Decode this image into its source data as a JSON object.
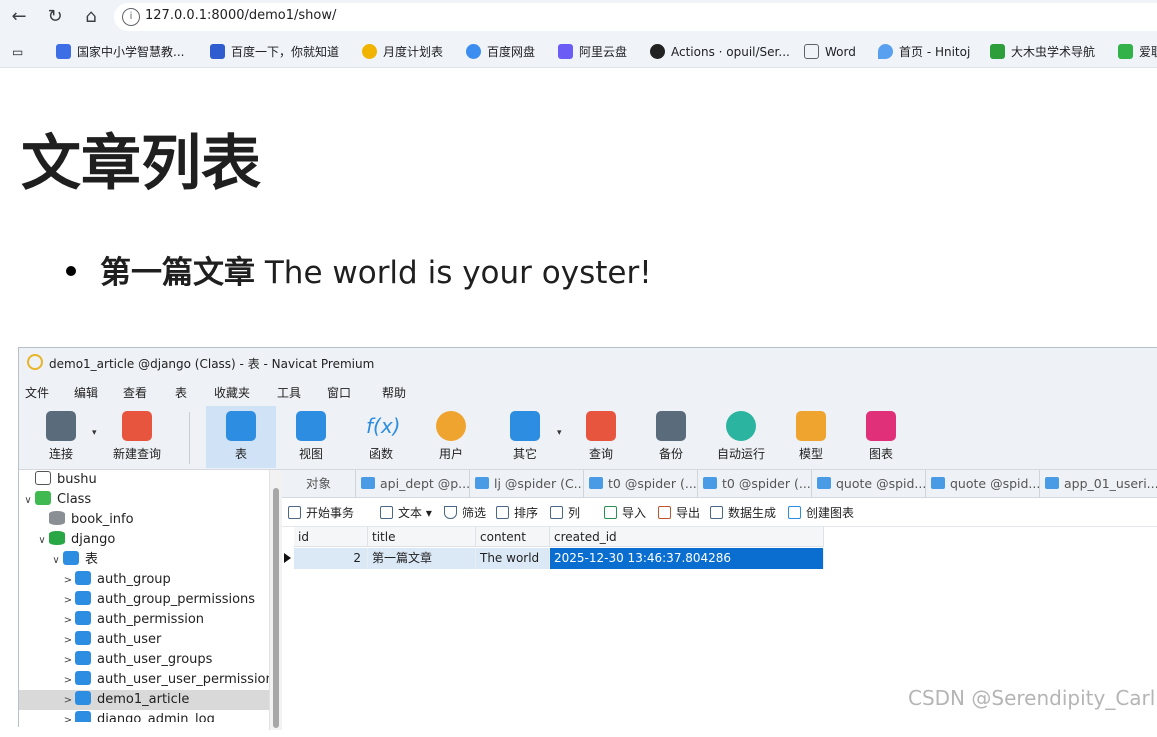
{
  "browser": {
    "url": "127.0.0.1:8000/demo1/show/",
    "bookmarks": [
      {
        "label": "国家中小学智慧教...",
        "color": "#3d6ee6"
      },
      {
        "label": "百度一下，你就知道",
        "color": "#2f5ccf"
      },
      {
        "label": "月度计划表",
        "color": "#f0b400"
      },
      {
        "label": "百度网盘",
        "color": "#3b8ef0"
      },
      {
        "label": "阿里云盘",
        "color": "#6b5cf6"
      },
      {
        "label": "Actions · opuil/Ser...",
        "color": "#222222"
      },
      {
        "label": "Word",
        "color": "#5f6368"
      },
      {
        "label": "首页 - Hnitoj",
        "color": "#5aa0f0"
      },
      {
        "label": "大木虫学术导航",
        "color": "#2e9e3a"
      },
      {
        "label": "爱职",
        "color": "#33b24a"
      }
    ]
  },
  "page": {
    "heading": "文章列表",
    "articles": [
      {
        "title": "第一篇文章",
        "content": "The world is your oyster!"
      }
    ]
  },
  "navicat": {
    "title": "demo1_article @django (Class) - 表 - Navicat Premium",
    "menus": [
      "文件",
      "编辑",
      "查看",
      "表",
      "收藏夹",
      "工具",
      "窗口",
      "帮助"
    ],
    "toolbar": [
      {
        "label": "连接",
        "color": "#5a6b7c"
      },
      {
        "label": "新建查询",
        "color": "#e8553f"
      },
      {
        "label": "表",
        "color": "#2d8de0"
      },
      {
        "label": "视图",
        "color": "#2d8de0"
      },
      {
        "label": "函数",
        "color": "#2d8de0"
      },
      {
        "label": "用户",
        "color": "#f0a430"
      },
      {
        "label": "其它",
        "color": "#2d8de0"
      },
      {
        "label": "查询",
        "color": "#e8553f"
      },
      {
        "label": "备份",
        "color": "#5a6b7c"
      },
      {
        "label": "自动运行",
        "color": "#2bb5a0"
      },
      {
        "label": "模型",
        "color": "#f0a430"
      },
      {
        "label": "图表",
        "color": "#e0307a"
      }
    ],
    "tree": [
      {
        "label": "bushu",
        "arrow": ""
      },
      {
        "label": "Class",
        "arrow": "∨"
      },
      {
        "label": "book_info",
        "arrow": ""
      },
      {
        "label": "django",
        "arrow": "∨"
      },
      {
        "label": "表",
        "arrow": "∨"
      },
      {
        "label": "auth_group",
        "arrow": ">"
      },
      {
        "label": "auth_group_permissions",
        "arrow": ">"
      },
      {
        "label": "auth_permission",
        "arrow": ">"
      },
      {
        "label": "auth_user",
        "arrow": ">"
      },
      {
        "label": "auth_user_groups",
        "arrow": ">"
      },
      {
        "label": "auth_user_user_permissions",
        "arrow": ">"
      },
      {
        "label": "demo1_article",
        "arrow": ">"
      },
      {
        "label": "django_admin_log",
        "arrow": ">"
      }
    ],
    "tabs": [
      "对象",
      "api_dept @p...",
      "lj @spider (C...",
      "t0 @spider (...",
      "t0 @spider (...",
      "quote @spid...",
      "quote @spid...",
      "app_01_useri..."
    ],
    "actions": [
      "开始事务",
      "文本",
      "筛选",
      "排序",
      "列",
      "导入",
      "导出",
      "数据生成",
      "创建图表"
    ],
    "grid": {
      "columns": [
        "id",
        "title",
        "content",
        "created_id"
      ],
      "rows": [
        [
          "2",
          "第一篇文章",
          "The world",
          "2025-12-30 13:46:37.804286"
        ]
      ]
    }
  },
  "watermark": "CSDN @Serendipity_Carl"
}
